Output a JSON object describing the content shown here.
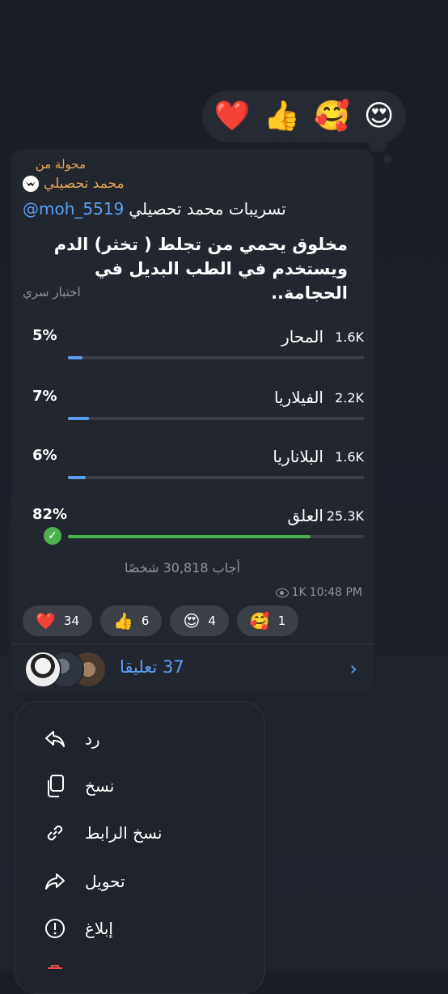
{
  "reaction_picker": [
    "❤️",
    "👍",
    "🥰",
    "😍"
  ],
  "message": {
    "forwarded_label": "محولة من",
    "forwarded_from": "محمد تحصيلي",
    "channel_title": "تسريبات محمد تحصيلي",
    "channel_handle": "@moh_5519",
    "question": "مخلوق يحمي من تجلط ( تخثر) الدم ويستخدم في الطب البديل في الحجامة..",
    "quiz_type": "اختبار سري",
    "options": [
      {
        "label": "المحار",
        "count": "1.6K",
        "percent_text": "5%",
        "percent": 5,
        "correct": false
      },
      {
        "label": "الفيلاريا",
        "count": "2.2K",
        "percent_text": "7%",
        "percent": 7,
        "correct": false
      },
      {
        "label": "البلاناريا",
        "count": "1.6K",
        "percent_text": "6%",
        "percent": 6,
        "correct": false
      },
      {
        "label": "العلق",
        "count": "25.3K",
        "percent_text": "82%",
        "percent": 82,
        "correct": true
      }
    ],
    "voters": "أجاب 30,818 شخصًا",
    "views": "1K",
    "time": "10:48 PM",
    "reactions": [
      {
        "emoji": "❤️",
        "count": "34"
      },
      {
        "emoji": "👍",
        "count": "6"
      },
      {
        "emoji": "😍",
        "count": "4"
      },
      {
        "emoji": "🥰",
        "count": "1"
      }
    ],
    "comments": "37 تعليقا"
  },
  "menu": {
    "items": [
      {
        "label": "رد",
        "icon": "reply-icon"
      },
      {
        "label": "نسخ",
        "icon": "copy-icon"
      },
      {
        "label": "نسخ الرابط",
        "icon": "link-icon"
      },
      {
        "label": "تحويل",
        "icon": "forward-icon"
      },
      {
        "label": "إبلاغ",
        "icon": "report-icon"
      }
    ]
  },
  "colors": {
    "accent": "#5b9ef5",
    "forward": "#e7a65a",
    "correct": "#4cb050",
    "bubble": "#22262e"
  }
}
